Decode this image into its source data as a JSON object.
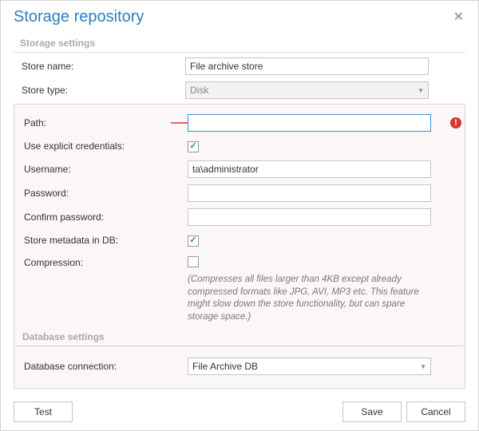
{
  "title": "Storage repository",
  "sections": {
    "storage_settings": "Storage settings",
    "database_settings": "Database settings"
  },
  "labels": {
    "store_name": "Store name:",
    "store_type": "Store type:",
    "path": "Path:",
    "use_explicit_credentials": "Use explicit credentials:",
    "username": "Username:",
    "password": "Password:",
    "confirm_password": "Confirm password:",
    "store_metadata_in_db": "Store metadata in DB:",
    "compression": "Compression:",
    "database_connection": "Database connection:"
  },
  "values": {
    "store_name": "File archive store",
    "store_type": "Disk",
    "path": "",
    "use_explicit_credentials": true,
    "username": "ta\\administrator",
    "password": "",
    "confirm_password": "",
    "store_metadata_in_db": true,
    "compression": false,
    "database_connection": "File Archive DB"
  },
  "compression_hint": "(Compresses all files larger than 4KB except already compressed formats like JPG, AVI, MP3 etc. This feature might slow down the store functionality, but can spare storage space.)",
  "error_icon_glyph": "!",
  "buttons": {
    "test": "Test",
    "save": "Save",
    "cancel": "Cancel"
  },
  "colors": {
    "accent": "#2b7ec1",
    "error": "#d9362f",
    "callout_arrow": "#d9362f"
  }
}
